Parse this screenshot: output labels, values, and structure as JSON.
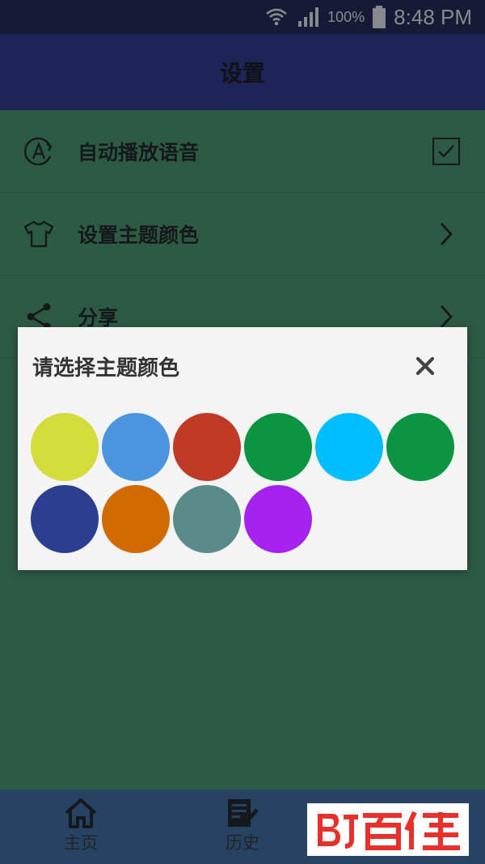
{
  "status_bar": {
    "battery": "100%",
    "time": "8:48 PM"
  },
  "app_bar": {
    "title": "设置"
  },
  "settings": [
    {
      "label": "自动播放语音",
      "icon": "auto-play-icon",
      "trailing": "checkbox"
    },
    {
      "label": "设置主题颜色",
      "icon": "tshirt-icon",
      "trailing": "chevron"
    },
    {
      "label": "分享",
      "icon": "share-icon",
      "trailing": "chevron"
    }
  ],
  "dialog": {
    "title": "请选择主题颜色",
    "close_icon": "close-icon",
    "swatches": [
      "#d0dd3a",
      "#4a95e0",
      "#c03a25",
      "#0b9442",
      "#00bfff",
      "#0b9442",
      "#2a3f8f",
      "#d16a00",
      "#5a8a89",
      "#a623ef"
    ]
  },
  "bottom_nav": [
    {
      "label": "主页",
      "icon": "home-icon"
    },
    {
      "label": "历史",
      "icon": "history-icon"
    }
  ],
  "colors": {
    "primary": "#2a3696",
    "accent": "#4aa071",
    "nav": "#3f72ad"
  }
}
